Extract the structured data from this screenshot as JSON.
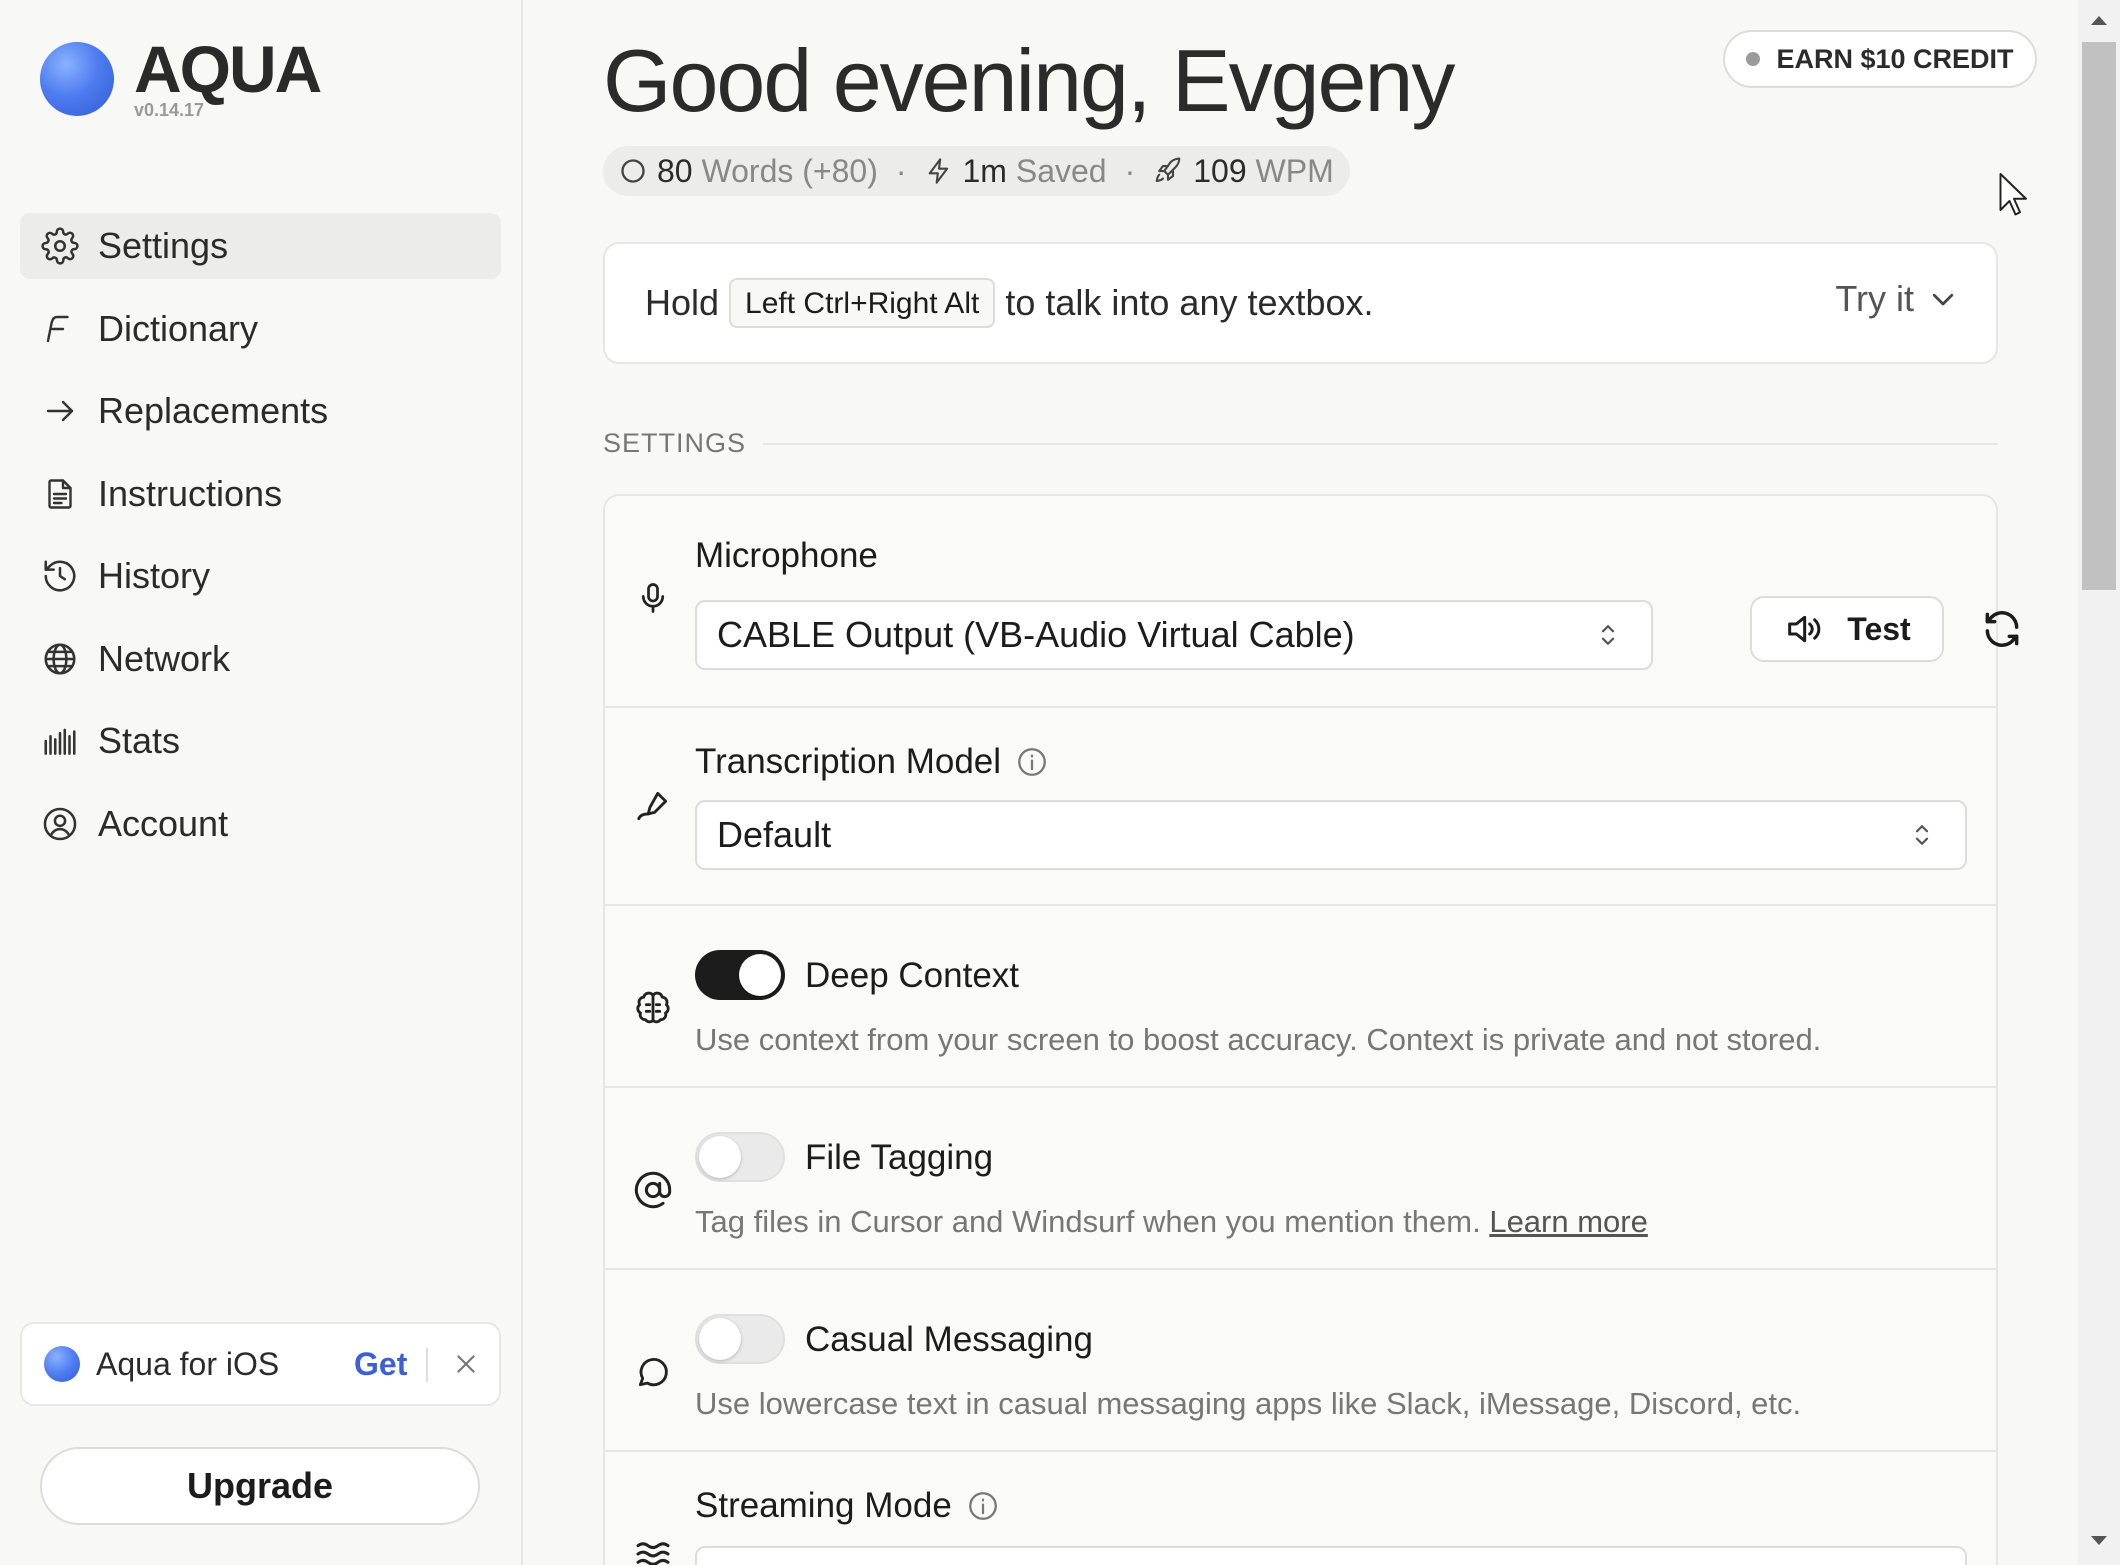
{
  "brand": {
    "name": "AQUA",
    "version": "v0.14.17"
  },
  "sidebar": {
    "items": [
      {
        "label": "Settings",
        "icon": "gear-icon",
        "active": true
      },
      {
        "label": "Dictionary",
        "icon": "dictionary-icon",
        "active": false
      },
      {
        "label": "Replacements",
        "icon": "arrow-right-icon",
        "active": false
      },
      {
        "label": "Instructions",
        "icon": "document-icon",
        "active": false
      },
      {
        "label": "History",
        "icon": "history-icon",
        "active": false
      },
      {
        "label": "Network",
        "icon": "globe-icon",
        "active": false
      },
      {
        "label": "Stats",
        "icon": "bars-icon",
        "active": false
      },
      {
        "label": "Account",
        "icon": "user-circle-icon",
        "active": false
      }
    ],
    "ios_promo": {
      "label": "Aqua for iOS",
      "get_label": "Get"
    },
    "upgrade_label": "Upgrade"
  },
  "header": {
    "greeting": "Good evening, Evgeny",
    "earn_label": "EARN $10 CREDIT",
    "stats": {
      "words": "80",
      "words_label": "Words (+80)",
      "saved": "1m",
      "saved_label": "Saved",
      "wpm": "109",
      "wpm_label": "WPM"
    }
  },
  "hold_bar": {
    "prefix": "Hold",
    "shortcut": "Left Ctrl+Right Alt",
    "suffix": "to talk into any textbox.",
    "try_label": "Try it"
  },
  "settings": {
    "section_title": "SETTINGS",
    "microphone": {
      "title": "Microphone",
      "value": "CABLE Output (VB-Audio Virtual Cable)",
      "test_label": "Test"
    },
    "transcription": {
      "title": "Transcription Model",
      "value": "Default"
    },
    "deep_context": {
      "title": "Deep Context",
      "enabled": true,
      "desc": "Use context from your screen to boost accuracy. Context is private and not stored."
    },
    "file_tagging": {
      "title": "File Tagging",
      "enabled": false,
      "desc": "Tag files in Cursor and Windsurf when you mention them.",
      "link": "Learn more"
    },
    "casual_messaging": {
      "title": "Casual Messaging",
      "enabled": false,
      "desc": "Use lowercase text in casual messaging apps like Slack, iMessage, Discord, etc."
    },
    "streaming_mode": {
      "title": "Streaming Mode"
    }
  },
  "colors": {
    "accent": "#4f7df0",
    "link": "#3d5fd6",
    "toggle_on": "#1c1c1c"
  }
}
